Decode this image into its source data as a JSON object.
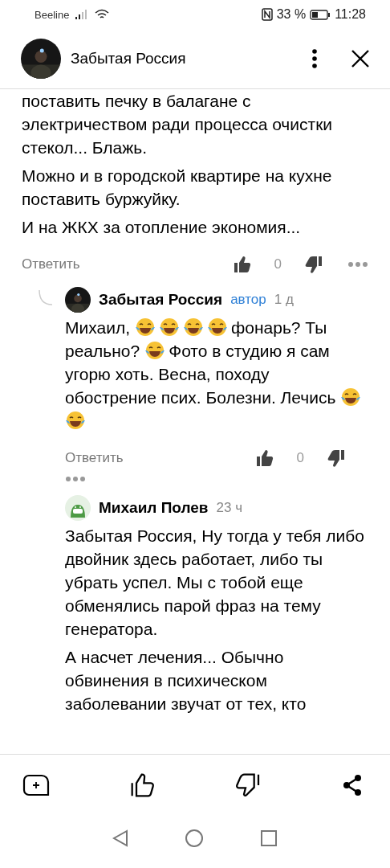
{
  "status_bar": {
    "carrier": "Beeline",
    "battery": "33 %",
    "time": "11:28"
  },
  "header": {
    "title": "Забытая Россия",
    "avatar": {
      "kind": "picture"
    }
  },
  "comments": [
    {
      "kind": "top",
      "paragraphs": [
        [
          {
            "kind": "text",
            "text": "поставить печку в балагане с электричеством ради процесса очистки стекол... Блажь."
          }
        ],
        [
          {
            "kind": "text",
            "text": "Можно и в городской квартире на кухне поставить буржуйку."
          }
        ],
        [
          {
            "kind": "text",
            "text": "И на ЖКХ за отопление экономия..."
          }
        ]
      ],
      "reply": "Ответить",
      "likes": "0"
    },
    {
      "kind": "reply",
      "thread_line": true,
      "author": "Забытая Россия",
      "avatar": {
        "kind": "picture"
      },
      "badge": "автор",
      "time": "1 д",
      "paragraphs": [
        [
          {
            "kind": "text",
            "text": "Михаил,"
          },
          {
            "kind": "emoji"
          },
          {
            "kind": "emoji"
          },
          {
            "kind": "emoji"
          },
          {
            "kind": "emoji"
          },
          {
            "kind": "text",
            "text": "фонарь? Ты"
          },
          {
            "kind": "break"
          },
          {
            "kind": "text",
            "text": "реально?"
          },
          {
            "kind": "emoji"
          },
          {
            "kind": "text",
            "text": "Фото в студию я сам"
          },
          {
            "kind": "break"
          },
          {
            "kind": "text",
            "text": "угорю хоть. Весна, походу"
          },
          {
            "kind": "break"
          },
          {
            "kind": "text",
            "text": "обострение псих. Болезни. Лечись"
          },
          {
            "kind": "emoji"
          },
          {
            "kind": "break"
          },
          {
            "kind": "emoji"
          }
        ]
      ],
      "reply": "Ответить",
      "likes": "0"
    },
    {
      "kind": "reply",
      "thread_line": false,
      "author": "Михаил Полев",
      "avatar": {
        "kind": "icon"
      },
      "time": "23 ч",
      "paragraphs": [
        [
          {
            "kind": "text",
            "text": "Забытая Россия, Ну тогда у тебя либо двойник здесь работает, либо ты убрать успел. Мы с тобой еще обменялись парой фраз на тему генератора."
          }
        ],
        [
          {
            "kind": "text",
            "text": "А насчет лечения... Обычно обвинения в психическом заболевании звучат от тех, кто"
          }
        ]
      ]
    }
  ]
}
